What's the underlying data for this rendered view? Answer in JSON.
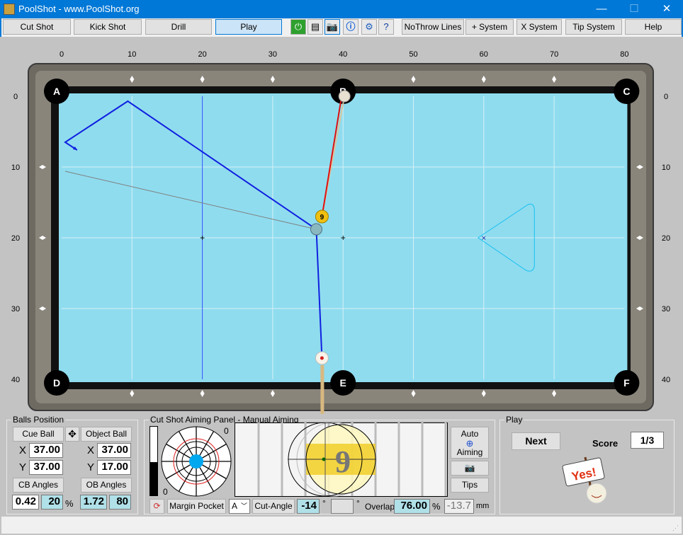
{
  "window": {
    "title": "PoolShot - www.PoolShot.org",
    "minimize": "—",
    "maximize": "☐",
    "close": "✕"
  },
  "toolbar": {
    "buttons": [
      "Cut Shot",
      "Kick Shot",
      "Drill",
      "Play"
    ],
    "selected": "Play",
    "icons": [
      "power-icon",
      "print-icon",
      "camera-icon",
      "info-icon",
      "settings-icon",
      "help-doc-icon"
    ],
    "right_buttons": [
      "NoThrow Lines",
      "+ System",
      "X System",
      "Tip System",
      "Help"
    ]
  },
  "table": {
    "x_ticks": [
      "0",
      "10",
      "20",
      "30",
      "40",
      "50",
      "60",
      "70",
      "80"
    ],
    "y_ticks": [
      "0",
      "10",
      "20",
      "30",
      "40"
    ],
    "pockets": [
      "A",
      "B",
      "C",
      "D",
      "E",
      "F"
    ],
    "cloth_color": "#8fdcef",
    "cue_ball": {
      "x": 37,
      "y": 37
    },
    "object_ball": {
      "x": 37,
      "y": 17,
      "number": "9"
    },
    "shot_color": "#1020e0",
    "object_path_color": "#e01010"
  },
  "balls_position": {
    "title": "Balls Position",
    "cue_ball_label": "Cue Ball",
    "object_ball_label": "Object Ball",
    "x_label": "X",
    "y_label": "Y",
    "cb_x": "37.00",
    "cb_y": "37.00",
    "ob_x": "37.00",
    "ob_y": "17.00",
    "cb_angles_label": "CB Angles",
    "ob_angles_label": "OB Angles",
    "cb_angle_1": "0.42",
    "cb_angle_2": "20",
    "percent": "%",
    "ob_angle_1": "1.72",
    "ob_angle_2": "80"
  },
  "aiming": {
    "title": "Cut Shot Aiming Panel - Manual Aiming",
    "bar_top": "0",
    "bar_bottom": "0",
    "margin_pocket": "Margin Pocket",
    "pocket_select": "A",
    "cut_angle_label": "Cut-Angle",
    "cut_angle": "-14",
    "deg": "°",
    "overlap_label": "Overlap",
    "overlap": "76.00",
    "overlap_unit": "%",
    "offset": "-13.7",
    "offset_unit": "mm",
    "auto_aiming_1": "Auto",
    "auto_aiming_2": "Aiming",
    "tips": "Tips",
    "ball_number": "9"
  },
  "play": {
    "title": "Play",
    "next": "Next",
    "score_label": "Score",
    "score": "1/3",
    "sign_text": "Yes!"
  }
}
